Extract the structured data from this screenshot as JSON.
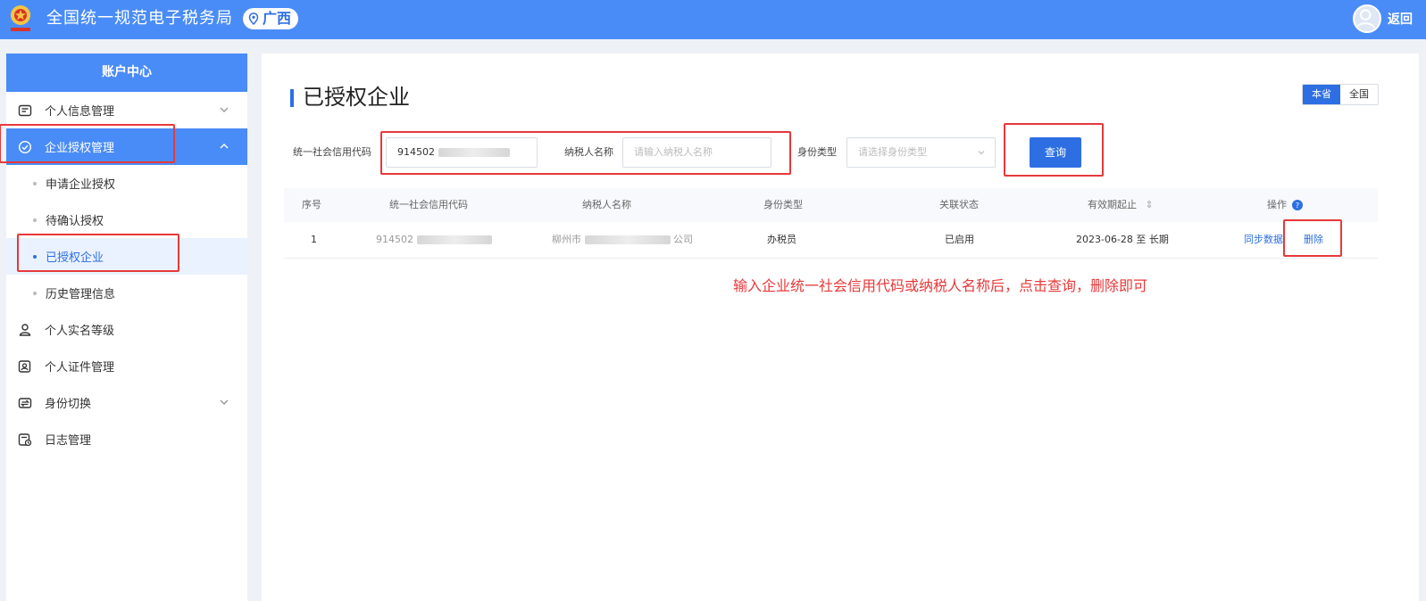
{
  "colors": {
    "header_bg": "#4a8cf7",
    "accent": "#2d6fe3",
    "highlight": "#e8383a"
  },
  "header": {
    "title": "全国统一规范电子税务局",
    "region": "广西",
    "back_label": "返回",
    "icons": [
      "tax-emblem-icon",
      "location-pin-icon",
      "user-avatar-icon"
    ]
  },
  "sidebar": {
    "title": "账户中心",
    "items": [
      {
        "label": "个人信息管理",
        "icon": "id-card-icon",
        "expandable": true,
        "expanded": false
      },
      {
        "label": "企业授权管理",
        "icon": "shield-check-icon",
        "expandable": true,
        "expanded": true,
        "active": true,
        "children": [
          {
            "label": "申请企业授权"
          },
          {
            "label": "待确认授权"
          },
          {
            "label": "已授权企业",
            "selected": true
          },
          {
            "label": "历史管理信息"
          }
        ]
      },
      {
        "label": "个人实名等级",
        "icon": "user-level-icon",
        "expandable": false
      },
      {
        "label": "个人证件管理",
        "icon": "certificate-icon",
        "expandable": false
      },
      {
        "label": "身份切换",
        "icon": "switch-identity-icon",
        "expandable": true,
        "expanded": false
      },
      {
        "label": "日志管理",
        "icon": "log-icon",
        "expandable": false
      }
    ]
  },
  "main": {
    "title": "已授权企业",
    "scope": {
      "options": [
        "本省",
        "全国"
      ],
      "selected": "本省"
    },
    "filters": {
      "credit_code": {
        "label": "统一社会信用代码",
        "value": "914502"
      },
      "taxpayer_name": {
        "label": "纳税人名称",
        "placeholder": "请输入纳税人名称"
      },
      "identity_type": {
        "label": "身份类型",
        "placeholder": "请选择身份类型"
      }
    },
    "query_label": "查询",
    "table": {
      "columns": [
        "序号",
        "统一社会信用代码",
        "纳税人名称",
        "身份类型",
        "关联状态",
        "有效期起止",
        "操作"
      ],
      "rows": [
        {
          "index": "1",
          "credit_code": "914502",
          "taxpayer_name_prefix": "柳州市",
          "taxpayer_name_suffix": "公司",
          "identity_type": "办税员",
          "status": "已启用",
          "validity": "2023-06-28 至 长期",
          "actions": [
            "同步数据",
            "删除"
          ]
        }
      ]
    },
    "note": "输入企业统一社会信用代码或纳税人名称后，点击查询，删除即可"
  }
}
